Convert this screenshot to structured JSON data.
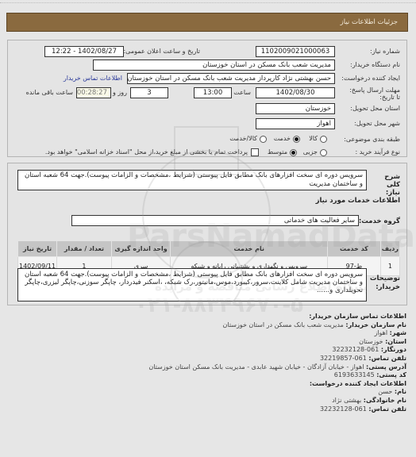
{
  "header": {
    "title": "جزئیات اطلاعات نیاز"
  },
  "summary": {
    "need_number_label": "شماره نیاز:",
    "need_number": "1102009021000063",
    "announce_label": "تاریخ و ساعت اعلان عمومی:",
    "announce_value": "1402/08/27 - 12:22",
    "buyer_org_label": "نام دستگاه خریدار:",
    "buyer_org": "مدیریت شعب بانک مسکن در استان خوزستان",
    "creator_label": "ایجاد کننده درخواست:",
    "creator": "حسن بهشتی نژاد کارپرداز مدیریت شعب بانک مسکن در استان خوزستان",
    "contact_link": "اطلاعات تماس خریدار",
    "deadline_label": "مهلت ارسال پاسخ: تا تاریخ:",
    "deadline_date": "1402/08/30",
    "time_label": "ساعت",
    "deadline_time": "13:00",
    "days": "3",
    "days_label": "روز و",
    "remaining": "00:28:27",
    "remaining_label": "ساعت باقی مانده",
    "province_label": "استان محل تحویل:",
    "province": "خوزستان",
    "city_label": "شهر محل تحویل:",
    "city": "اهواز",
    "category_label": "طبقه بندی موضوعی:",
    "category_options": [
      {
        "label": "کالا",
        "selected": false
      },
      {
        "label": "خدمت",
        "selected": true
      },
      {
        "label": "کالا/خدمت",
        "selected": false
      }
    ],
    "process_label": "نوع فرآیند خرید :",
    "process_options": [
      {
        "label": "جزیی",
        "selected": false
      },
      {
        "label": "متوسط",
        "selected": true
      }
    ],
    "payment_checkbox_label": "پرداخت تمام یا بخشی از مبلغ خرید،از محل \"اسناد خزانه اسلامی\" خواهد بود.",
    "payment_checked": false
  },
  "details": {
    "desc_label": "شرح کلی نیاز:",
    "description": "سرویس دوره ای سخت افزارهای بانک مطابق فایل پیوستی (شرایط ،مشخصات و الزامات پیوست).جهت 64 شعبه استان و ساختمان مدیریت",
    "services_heading": "اطلاعات خدمات مورد نیاز",
    "service_group_label": "گروه خدمت:",
    "service_group": "سایر فعالیت های خدماتی",
    "table": {
      "headers": [
        "ردیف",
        "کد خدمت",
        "نام خدمت",
        "واحد اندازه گیری",
        "تعداد / مقدار",
        "تاریخ نیاز"
      ],
      "rows": [
        [
          "1",
          "ط-97",
          "سرویس و نگهداری و پشتیبانی رایانه و شبکه",
          "سری",
          "1",
          "1402/09/11"
        ]
      ]
    },
    "buyer_notes_label": "توضیحات خریدار:",
    "buyer_notes": "سرویس دوره ای سخت افزارهای بانک مطابق فایل پیوستی (شرایط ،مشخصات و الزامات پیوست).جهت 64 شعبه استان و ساختمان مدیریت شامل کلاینت،سرور،کیبورد،موس،مانیتور،رک شبکه، ،اسکنر فیدردار، چاپگر سوزنی،چاپگر لیزری،چاپگر تحویلداری و......"
  },
  "contact": {
    "org_heading": "اطلاعات تماس سازمان خریدار:",
    "org_name_label": "نام سازمان خریدار:",
    "org_name": "مدیریت شعب بانک مسکن در استان خوزستان",
    "city_label": "شهر:",
    "city": "اهواز",
    "province_label": "استان:",
    "province": "خوزستان",
    "fax_label": "دورنگار:",
    "fax": "061-32232128",
    "phone_label": "تلفن تماس:",
    "phone": "061-32219857",
    "address_label": "آدرس پستی:",
    "address": "اهواز - خیابان آزادگان - خیابان شهید عابدی - مدیریت بانک مسکن استان خوزستان",
    "postal_label": "کد پستی:",
    "postal": "6193633145",
    "creator_heading": "اطلاعات ایجاد کننده درخواست:",
    "first_name_label": "نام:",
    "first_name": "حسن",
    "last_name_label": "نام خانوادگی:",
    "last_name": "بهشتی نژاد",
    "creator_phone_label": "تلفن تماس:",
    "creator_phone": "061-32232128"
  },
  "watermark": {
    "brand": "ParsNamadData",
    "phone": "۰۲۱-۸۸۳۴۹۶۷۰-۵",
    "tagline": "پایگاه اطلاع رسانی مناقصه و مزایده"
  }
}
